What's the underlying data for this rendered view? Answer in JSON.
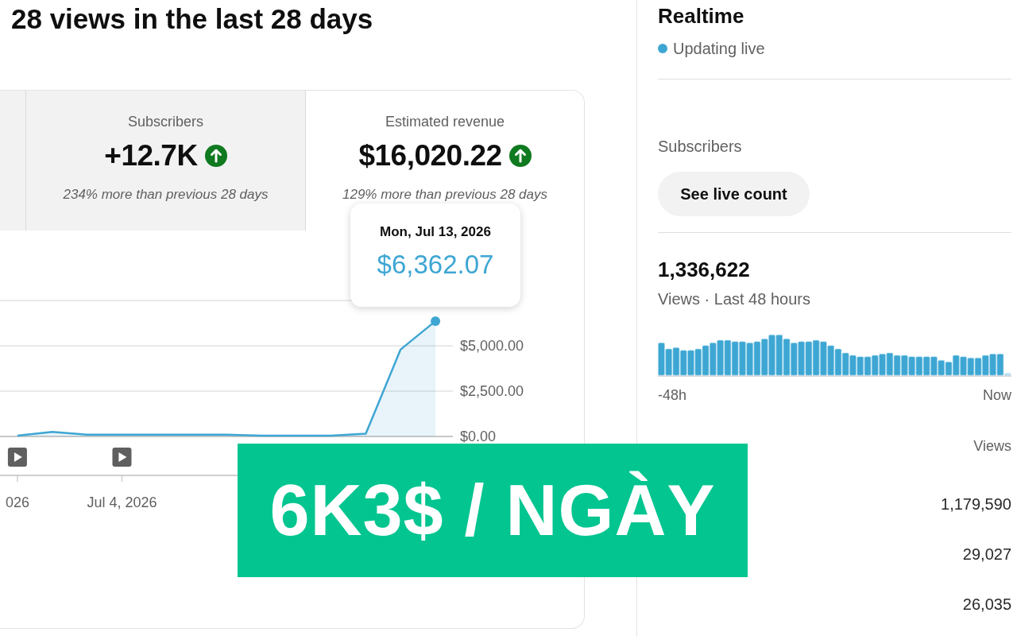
{
  "header": {
    "title": "28 views in the last 28 days"
  },
  "metrics": [
    {
      "selected": false
    },
    {
      "label": "Subscribers",
      "value": "+12.7K",
      "trend_up": true,
      "comparison": "234% more than previous 28 days",
      "selected": false
    },
    {
      "label": "Estimated revenue",
      "value": "$16,020.22",
      "trend_up": true,
      "comparison": "129% more than previous 28 days",
      "selected": true
    }
  ],
  "chart": {
    "tooltip": {
      "date": "Mon, Jul 13, 2026",
      "value": "$6,362.07"
    },
    "chart_data": {
      "type": "area",
      "categories": [
        "026",
        null,
        null,
        "Jul 4, 2026",
        null,
        null,
        null,
        null,
        null,
        null,
        null,
        null,
        null
      ],
      "series": [
        {
          "color": "#3ea6d3",
          "values": [
            50,
            250,
            100,
            100,
            100,
            100,
            100,
            50,
            50,
            50,
            150,
            4800,
            6362.07
          ]
        }
      ],
      "ylim": [
        0,
        7500
      ],
      "yticks": [
        {
          "value": 0,
          "label": "$0.00"
        },
        {
          "value": 2500,
          "label": "$2,500.00"
        },
        {
          "value": 5000,
          "label": "$5,000.00"
        }
      ],
      "annotations": [
        {
          "x": "026"
        },
        {
          "x": "Jul 4, 2026"
        }
      ]
    }
  },
  "realtime": {
    "title": "Realtime",
    "status": "Updating live",
    "subscribers_label": "Subscribers",
    "live_count_button": "See live count",
    "views_total": "1,336,622",
    "views_caption": "Views · Last 48 hours",
    "axis_start": "-48h",
    "axis_end": "Now",
    "top_content": {
      "views_header": "Views",
      "rows": [
        {
          "views": "1,179,590"
        },
        {
          "views": "29,027"
        },
        {
          "views": "26,035"
        }
      ]
    }
  },
  "caption_banner": {
    "text": "6K3$ / NGÀY"
  }
}
